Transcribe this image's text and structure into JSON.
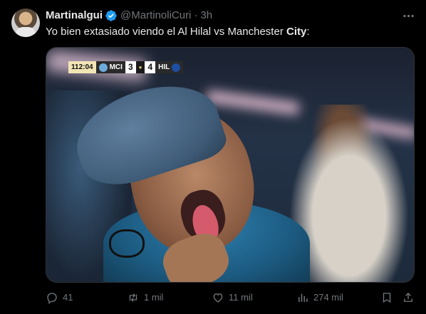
{
  "author": {
    "name": "Martinalgui",
    "handle": "@MartinoliCuri",
    "separator": "·",
    "time": "3h"
  },
  "text": {
    "part1": "Yo bien extasiado viendo el Al Hilal vs Manchester ",
    "bold": "City",
    "part2": ":"
  },
  "scorebug": {
    "clock": "112:04",
    "team1": "MCI",
    "score1": "3",
    "score2": "4",
    "team2": "HIL"
  },
  "actions": {
    "replies": "41",
    "retweets": "1 mil",
    "likes": "11 mil",
    "views": "274 mil"
  },
  "icons": {
    "verified": "verified-badge-icon",
    "more": "more-dots-icon",
    "reply": "reply-icon",
    "retweet": "retweet-icon",
    "like": "heart-icon",
    "views": "views-icon",
    "bookmark": "bookmark-icon",
    "share": "share-icon"
  },
  "colors": {
    "background": "#000000",
    "text": "#e7e9ea",
    "secondary": "#71767b",
    "verified": "#1d9bf0",
    "border": "#2f3336"
  }
}
